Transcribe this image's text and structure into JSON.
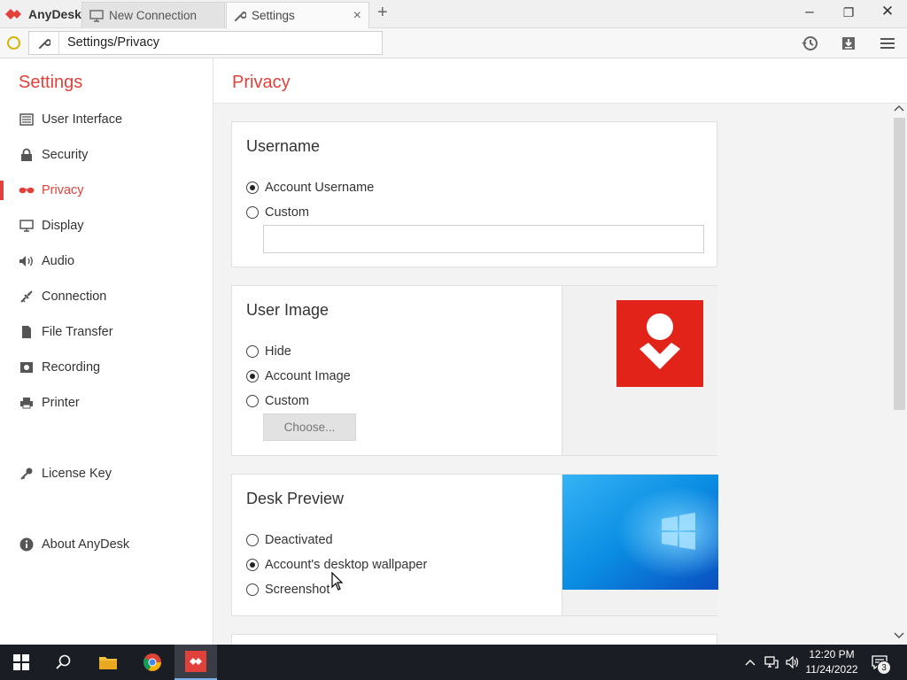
{
  "app": {
    "name": "AnyDesk",
    "brand_color": "#e2413b"
  },
  "tabs": [
    {
      "label": "New Connection",
      "icon": "monitor-icon"
    },
    {
      "label": "Settings",
      "icon": "wrench-icon",
      "close": "×"
    }
  ],
  "window_controls": {
    "minimize": "–",
    "restore": "❐",
    "close": "✕",
    "new_tab": "+"
  },
  "addressbar": {
    "value": "Settings/Privacy"
  },
  "sidebar": {
    "title": "Settings",
    "items": [
      {
        "label": "User Interface",
        "icon": "user-interface-icon"
      },
      {
        "label": "Security",
        "icon": "lock-icon"
      },
      {
        "label": "Privacy",
        "icon": "privacy-glasses-icon",
        "active": true
      },
      {
        "label": "Display",
        "icon": "monitor-icon"
      },
      {
        "label": "Audio",
        "icon": "speaker-icon"
      },
      {
        "label": "Connection",
        "icon": "connection-icon"
      },
      {
        "label": "File Transfer",
        "icon": "file-icon"
      },
      {
        "label": "Recording",
        "icon": "recording-icon"
      },
      {
        "label": "Printer",
        "icon": "printer-icon"
      },
      {
        "label": "License Key",
        "icon": "key-icon"
      },
      {
        "label": "About AnyDesk",
        "icon": "info-icon"
      }
    ]
  },
  "main": {
    "title": "Privacy",
    "username": {
      "title": "Username",
      "options": [
        {
          "label": "Account Username",
          "selected": true
        },
        {
          "label": "Custom",
          "selected": false
        }
      ],
      "custom_value": ""
    },
    "user_image": {
      "title": "User Image",
      "options": [
        {
          "label": "Hide",
          "selected": false
        },
        {
          "label": "Account Image",
          "selected": true
        },
        {
          "label": "Custom",
          "selected": false
        }
      ],
      "choose_label": "Choose..."
    },
    "desk_preview": {
      "title": "Desk Preview",
      "options": [
        {
          "label": "Deactivated",
          "selected": false
        },
        {
          "label": "Account's desktop wallpaper",
          "selected": true
        },
        {
          "label": "Screenshot",
          "selected": false
        }
      ]
    }
  },
  "taskbar": {
    "clock_time": "12:20 PM",
    "clock_date": "11/24/2022",
    "notification_count": "3"
  }
}
